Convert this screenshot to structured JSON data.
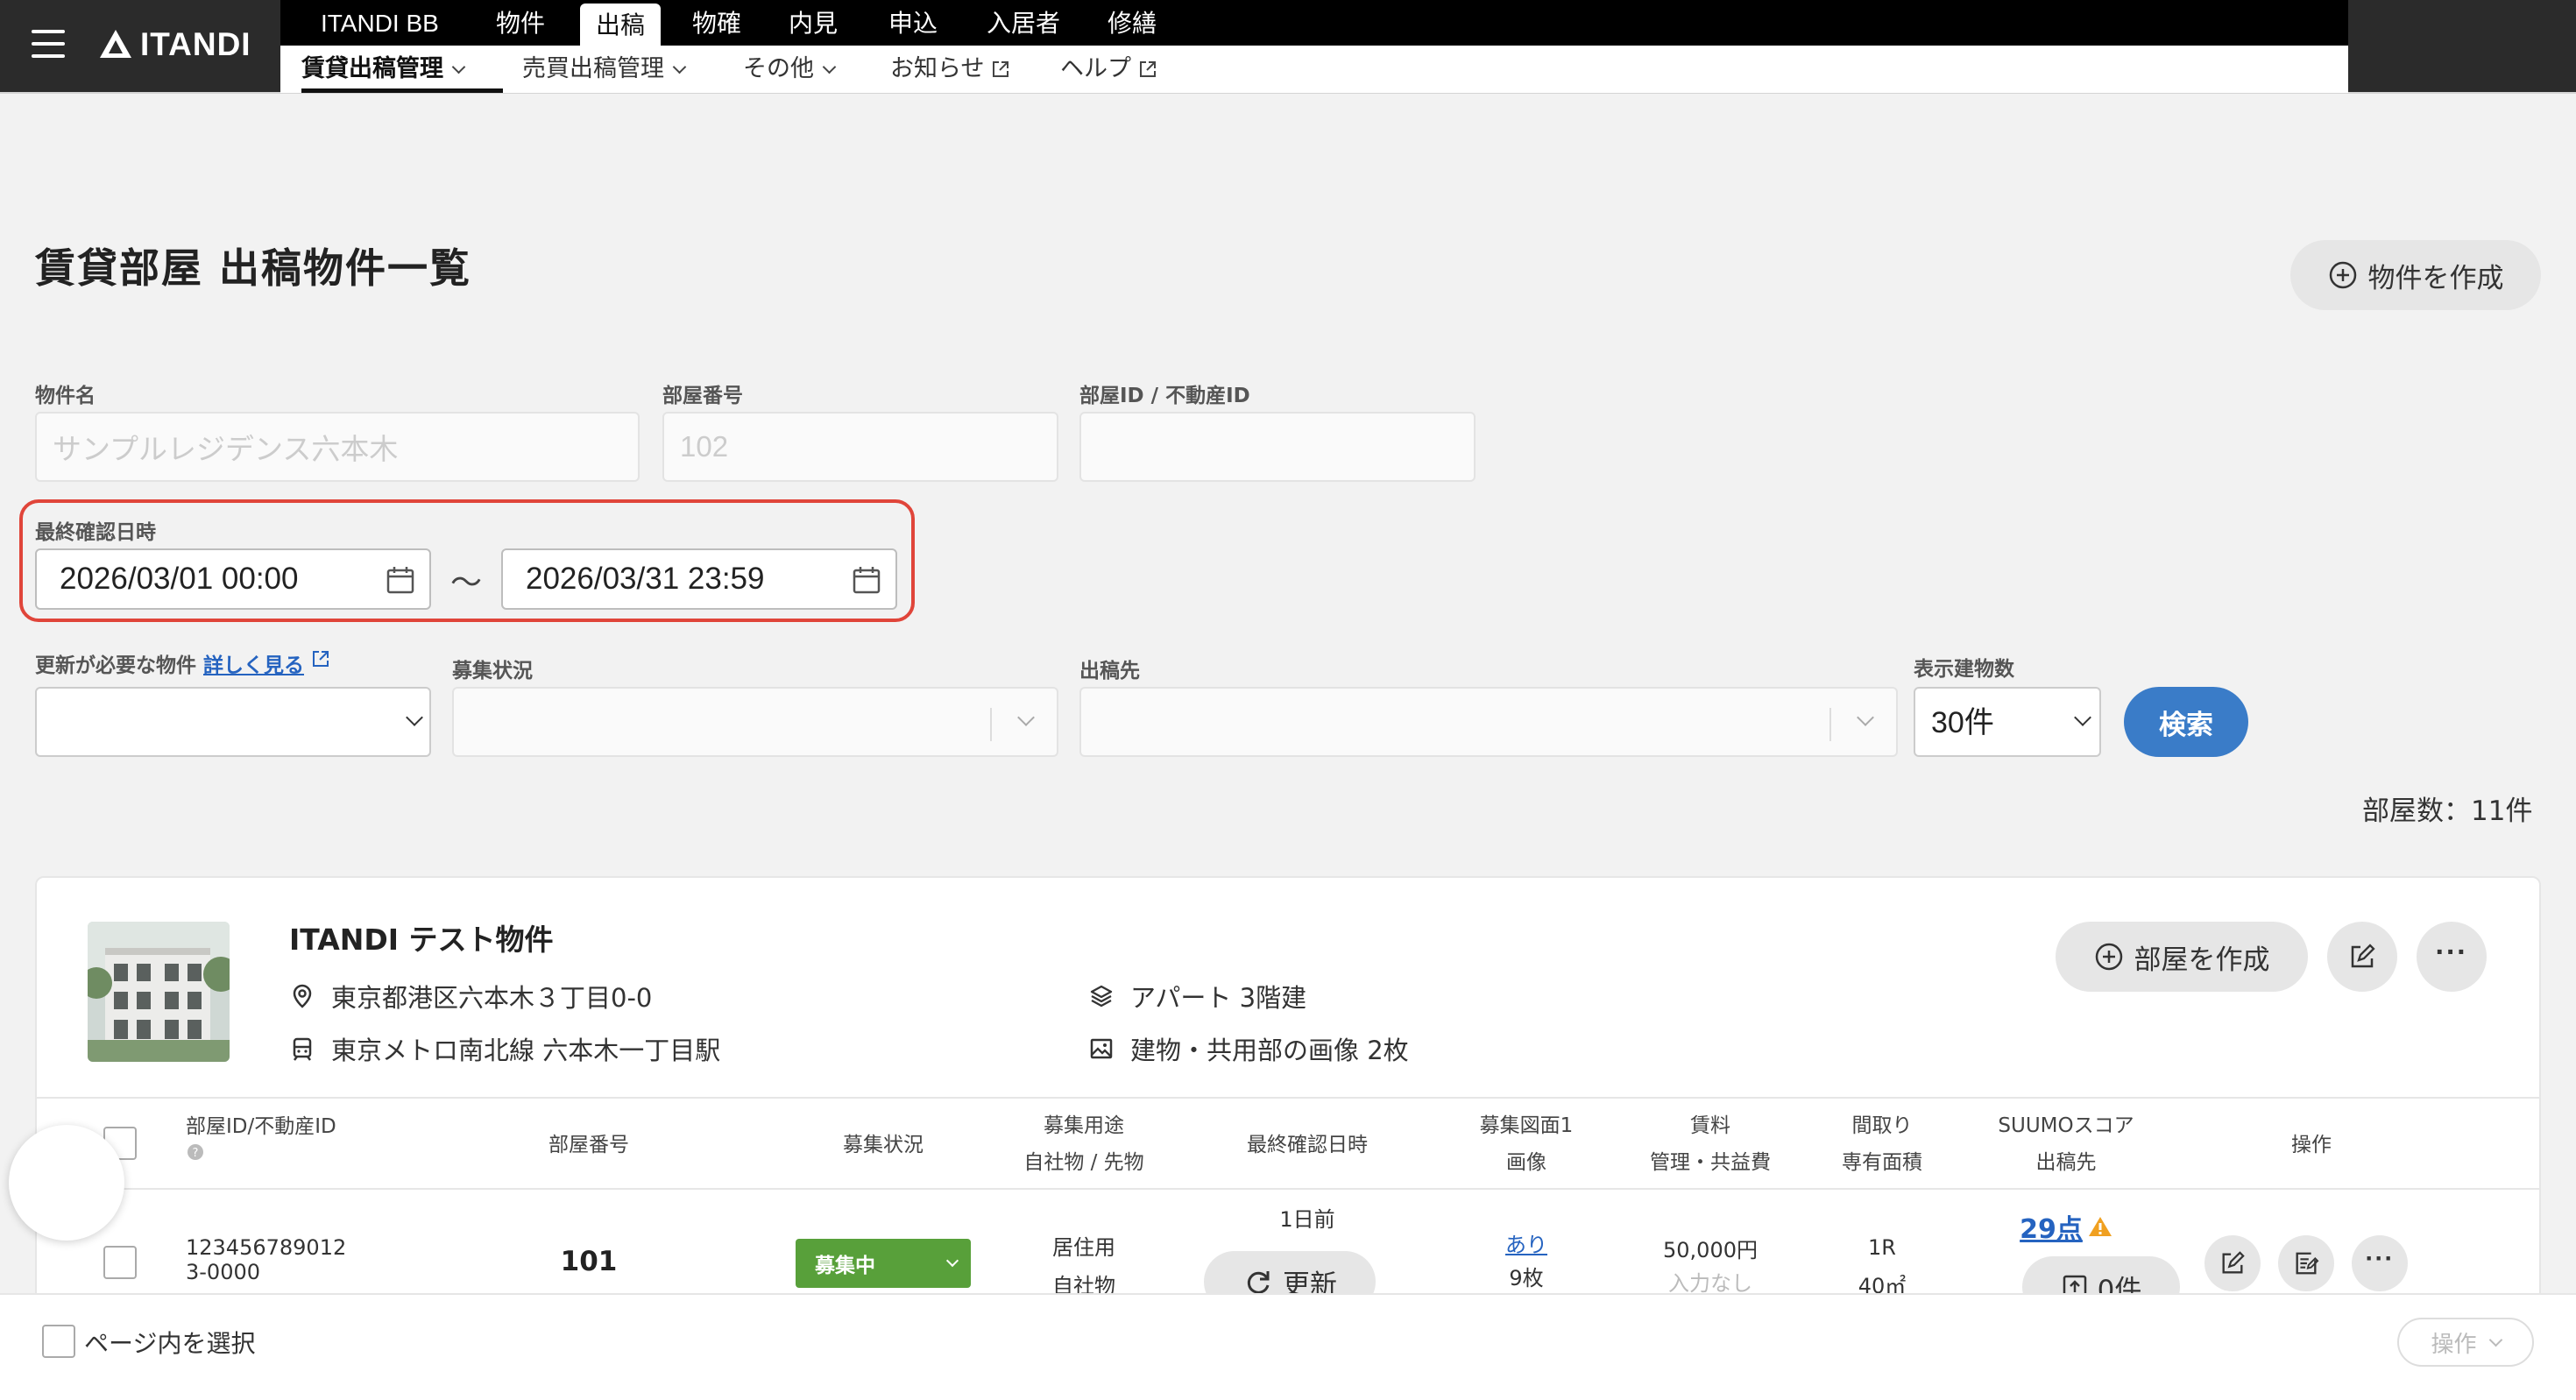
{
  "header": {
    "logo_text": "ITANDI",
    "top_nav": [
      "ITANDI BB",
      "物件",
      "出稿",
      "物確",
      "内見",
      "申込",
      "入居者",
      "修繕"
    ],
    "active_top": "出稿",
    "sub_nav": [
      {
        "label": "賃貸出稿管理",
        "has_dropdown": true,
        "active": true
      },
      {
        "label": "売買出稿管理",
        "has_dropdown": true
      },
      {
        "label": "その他",
        "has_dropdown": true
      },
      {
        "label": "お知らせ",
        "external": true
      },
      {
        "label": "ヘルプ",
        "external": true
      }
    ]
  },
  "page": {
    "title": "賃貸部屋 出稿物件一覧",
    "create_button": "物件を作成"
  },
  "filters": {
    "property_name": {
      "label": "物件名",
      "placeholder": "サンプルレジデンス六本木"
    },
    "room_number": {
      "label": "部屋番号",
      "placeholder": "102"
    },
    "room_id": {
      "label": "部屋ID / 不動産ID",
      "placeholder": ""
    },
    "last_checked": {
      "label": "最終確認日時",
      "from": "2026/03/01 00:00",
      "to": "2026/03/31 23:59",
      "separator": "〜"
    },
    "needs_update": {
      "label": "更新が必要な物件",
      "link": "詳しく見る"
    },
    "recruit_status": {
      "label": "募集状況"
    },
    "destination": {
      "label": "出稿先"
    },
    "display_count": {
      "label": "表示建物数",
      "value": "30件"
    },
    "search_button": "検索"
  },
  "room_count": "部屋数：11件",
  "property": {
    "name": "ITANDI テスト物件",
    "address": "東京都港区六本木３丁目0-0",
    "station": "東京メトロ南北線 六本木一丁目駅",
    "building_type": "アパート 3階建",
    "images": "建物・共用部の画像 2枚",
    "create_room_button": "部屋を作成"
  },
  "table": {
    "headers": {
      "room_id": "部屋ID/不動産ID",
      "room_number": "部屋番号",
      "status": "募集状況",
      "usage": [
        "募集用途",
        "自社物 / 先物"
      ],
      "last_checked": "最終確認日時",
      "floorplan": [
        "募集図面1",
        "画像"
      ],
      "rent": [
        "賃料",
        "管理・共益費"
      ],
      "layout": [
        "間取り",
        "専有面積"
      ],
      "suumo": [
        "SUUMOスコア",
        "出稿先"
      ],
      "actions": "操作"
    },
    "rows": [
      {
        "room_id": "123456789012\n3-0000",
        "room_number": "101",
        "status": "募集中",
        "usage": [
          "居住用",
          "自社物"
        ],
        "last_checked": "1日前",
        "update_button": "更新",
        "floorplan": "あり",
        "images": "9枚",
        "rent": "50,000円",
        "common_fee": "入力なし",
        "layout": "1R",
        "area": "40㎡",
        "suumo_score": "29点",
        "destination_count": "0件"
      }
    ]
  },
  "footer": {
    "select_page": "ページ内を選択",
    "operations": "操作"
  },
  "colors": {
    "header_bg": "#2b2b2b",
    "accent_blue": "#3a7cc8",
    "status_green": "#58a03a",
    "highlight_red": "#e0453a",
    "warning": "#f0a020"
  }
}
